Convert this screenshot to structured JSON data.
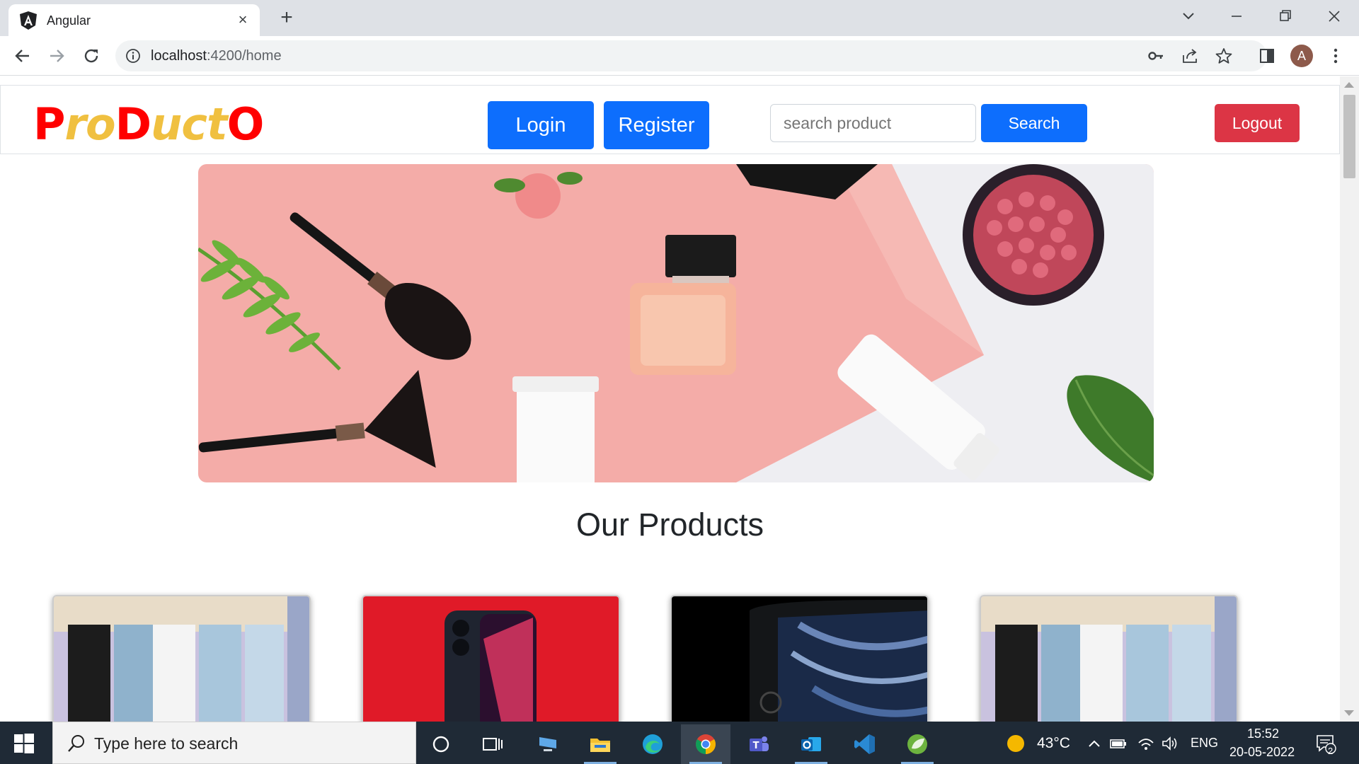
{
  "browser": {
    "tab_title": "Angular",
    "url_host": "localhost",
    "url_rest": ":4200/home",
    "profile_initial": "A"
  },
  "site": {
    "brand_parts": [
      "P",
      "ro",
      "D",
      "uct",
      "O"
    ],
    "login_label": "Login",
    "register_label": "Register",
    "search_placeholder": "search product",
    "search_label": "Search",
    "logout_label": "Logout",
    "section_title": "Our Products",
    "products": [
      {
        "image": "jeans-photo"
      },
      {
        "image": "phone-red-photo"
      },
      {
        "image": "phone-dark-photo"
      },
      {
        "image": "jeans-photo"
      }
    ],
    "hero_image": "cosmetics-banner"
  },
  "taskbar": {
    "search_placeholder": "Type here to search",
    "weather": "43°C",
    "language": "ENG",
    "time": "15:52",
    "date": "20-05-2022",
    "notification_count": "2"
  },
  "colors": {
    "primary": "#0d6efd",
    "danger": "#dc3545",
    "brand_red": "#ff0000",
    "brand_yellow": "#f0c040"
  }
}
